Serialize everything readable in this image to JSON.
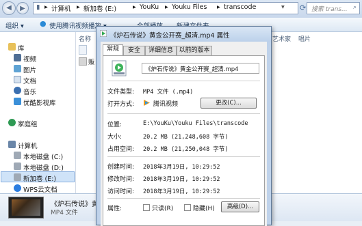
{
  "address": {
    "crumbs": [
      "计算机",
      "新加卷 (E:)",
      "YouKu",
      "Youku Files",
      "transcode"
    ],
    "search_placeholder": "搜索 trans..."
  },
  "toolbar": {
    "organize": "组织 ▾",
    "play_with": "使用腾讯视频播放 ▾",
    "play_all": "全部播放",
    "new_folder": "新建文件夹"
  },
  "file_list": {
    "col_name": "名称",
    "col_artist": "艺术家",
    "col_album": "唱片",
    "row_peek": "贩"
  },
  "nav": {
    "library": "库",
    "videos": "视频",
    "pictures": "图片",
    "documents": "文档",
    "music": "音乐",
    "youku": "优酷影视库",
    "homegroup": "家庭组",
    "computer": "计算机",
    "drive_c": "本地磁盘 (C:)",
    "drive_d": "本地磁盘 (D:)",
    "drive_e": "新加卷 (E:)",
    "wps": "WPS云文档"
  },
  "details": {
    "name": "《炉石传说》黄金公开赛_超清",
    "type": "MP4 文件"
  },
  "dialog": {
    "title": "《炉石传说》黄金公开赛_超清.mp4 属性",
    "tabs": [
      "常规",
      "安全",
      "详细信息",
      "以前的版本"
    ],
    "filename": "《炉石传说》黄金公开赛_超清.mp4",
    "file_type_label": "文件类型:",
    "file_type_value": "MP4 文件 (.mp4)",
    "open_with_label": "打开方式:",
    "open_with_value": "腾讯视频",
    "change_button": "更改(C)...",
    "location_label": "位置:",
    "location_value": "E:\\YouKu\\Youku Files\\transcode",
    "size_label": "大小:",
    "size_value": "20.2 MB (21,248,608 字节)",
    "size_on_disk_label": "占用空间:",
    "size_on_disk_value": "20.2 MB (21,250,048 字节)",
    "created_label": "创建时间:",
    "created_value": "2018年3月19日, 10:29:52",
    "modified_label": "修改时间:",
    "modified_value": "2018年3月19日, 10:29:52",
    "accessed_label": "访问时间:",
    "accessed_value": "2018年3月19日, 10:29:52",
    "attributes_label": "属性:",
    "readonly_label": "只读(R)",
    "hidden_label": "隐藏(H)",
    "advanced_button": "高级(D)..."
  },
  "colors": {
    "accent": "#1e3a5c",
    "selection": "#cfe3f8",
    "dialog_frame": "#bfd2ea"
  }
}
